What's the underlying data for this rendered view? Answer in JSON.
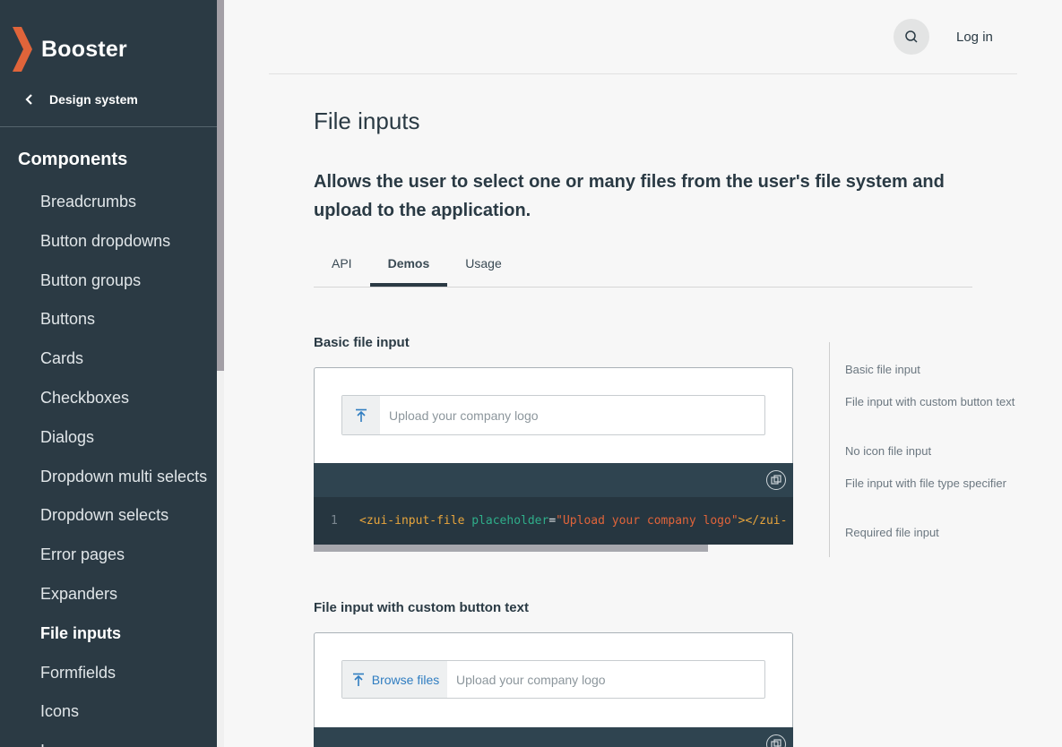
{
  "brand": {
    "name": "Booster",
    "accent": "#e0643a"
  },
  "sidebar": {
    "back_label": "Design system",
    "section_title": "Components",
    "items": [
      {
        "label": "Breadcrumbs"
      },
      {
        "label": "Button dropdowns"
      },
      {
        "label": "Button groups"
      },
      {
        "label": "Buttons"
      },
      {
        "label": "Cards"
      },
      {
        "label": "Checkboxes"
      },
      {
        "label": "Dialogs"
      },
      {
        "label": "Dropdown multi selects"
      },
      {
        "label": "Dropdown selects"
      },
      {
        "label": "Error pages"
      },
      {
        "label": "Expanders"
      },
      {
        "label": "File inputs",
        "active": true
      },
      {
        "label": "Formfields"
      },
      {
        "label": "Icons"
      },
      {
        "label": "I..."
      }
    ]
  },
  "header": {
    "search_icon": "search-icon",
    "login_label": "Log in"
  },
  "main": {
    "title": "File inputs",
    "lead": "Allows the user to select one or many files from the user's file system and upload to the application.",
    "tabs": [
      {
        "label": "API"
      },
      {
        "label": "Demos",
        "active": true
      },
      {
        "label": "Usage"
      }
    ],
    "demos": [
      {
        "title": "Basic file input",
        "placeholder": "Upload your company logo",
        "code": {
          "line": "1",
          "open_tag": "<zui-input-file",
          "attr": "placeholder",
          "eq": "=",
          "value": "\"Upload your company logo\"",
          "close": "></zui-"
        }
      },
      {
        "title": "File input with custom button text",
        "button_label": "Browse files",
        "placeholder": "Upload your company logo"
      }
    ]
  },
  "toc": {
    "items": [
      {
        "label": "Basic file input"
      },
      {
        "label": "File input with custom button text"
      },
      {
        "label": "No icon file input"
      },
      {
        "label": "File input with file type specifier"
      },
      {
        "label": "Required file input"
      }
    ]
  }
}
